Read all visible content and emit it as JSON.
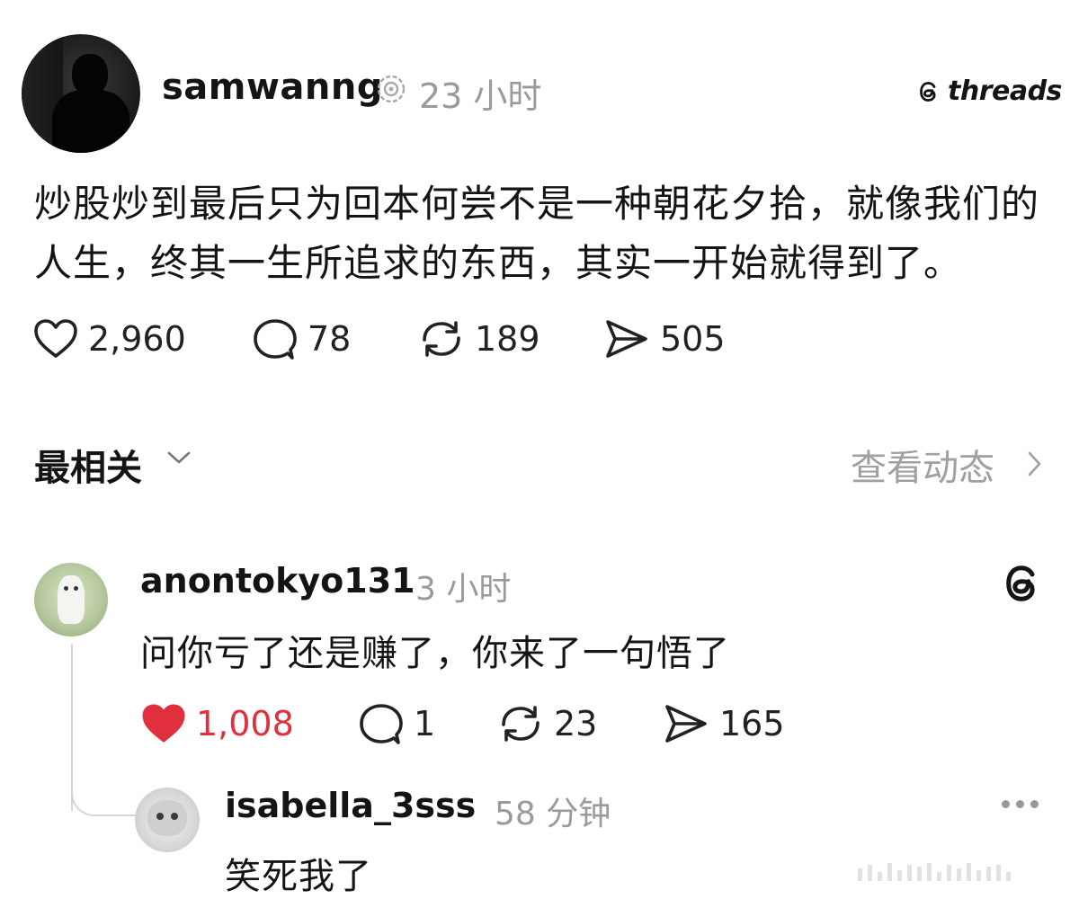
{
  "post": {
    "username": "samwanng",
    "time": "23 小时",
    "brand": "threads",
    "text": "炒股炒到最后只为回本何尝不是一种朝花夕拾，就像我们的人生，终其一生所追求的东西，其实一开始就得到了。",
    "stats": {
      "likes": "2,960",
      "comments": "78",
      "reposts": "189",
      "shares": "505"
    }
  },
  "sort": {
    "label": "最相关",
    "activity": "查看动态"
  },
  "comments": [
    {
      "username": "anontokyo131",
      "time": "3 小时",
      "text": "问你亏了还是赚了，你来了一句悟了",
      "stats": {
        "likes": "1,008",
        "comments": "1",
        "reposts": "23",
        "shares": "165"
      },
      "liked": true
    },
    {
      "username": "isabella_3sss",
      "time": "58 分钟",
      "text": "笑死我了"
    }
  ],
  "colors": {
    "liked": "#e0303e",
    "muted": "#9a9a9a",
    "text": "#141414"
  },
  "icons": [
    "threads-badge-icon",
    "threads-logo-icon",
    "heart-icon",
    "comment-icon",
    "repost-icon",
    "share-icon",
    "chevron-down-icon",
    "chevron-right-icon",
    "more-icon"
  ]
}
